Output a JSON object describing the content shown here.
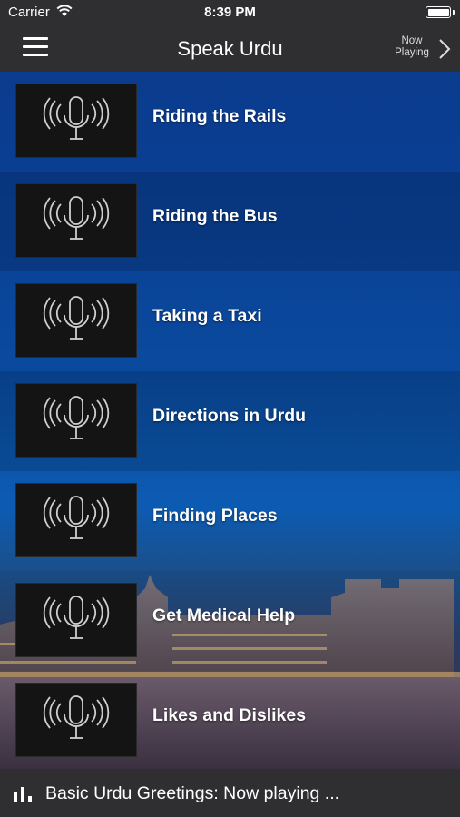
{
  "status_bar": {
    "carrier": "Carrier",
    "time": "8:39 PM",
    "wifi_icon": "wifi-icon",
    "battery_icon": "battery-icon"
  },
  "nav": {
    "title": "Speak Urdu",
    "menu_icon": "hamburger-menu-icon",
    "now_playing_line1": "Now",
    "now_playing_line2": "Playing",
    "chevron_icon": "chevron-right-icon"
  },
  "lessons": [
    {
      "label": "Riding the Rails",
      "icon": "microphone-icon"
    },
    {
      "label": "Riding the Bus",
      "icon": "microphone-icon"
    },
    {
      "label": "Taking a Taxi",
      "icon": "microphone-icon"
    },
    {
      "label": "Directions in Urdu",
      "icon": "microphone-icon"
    },
    {
      "label": "Finding Places",
      "icon": "microphone-icon"
    },
    {
      "label": "Get Medical Help",
      "icon": "microphone-icon"
    },
    {
      "label": "Likes and Dislikes",
      "icon": "microphone-icon"
    }
  ],
  "player": {
    "icon": "equalizer-icon",
    "text": "Basic Urdu Greetings: Now playing ..."
  },
  "colors": {
    "bar_background": "#2f2f31",
    "sky_top": "#0b3a8a",
    "sky_bottom": "#2e2a3a",
    "text": "#ffffff"
  }
}
